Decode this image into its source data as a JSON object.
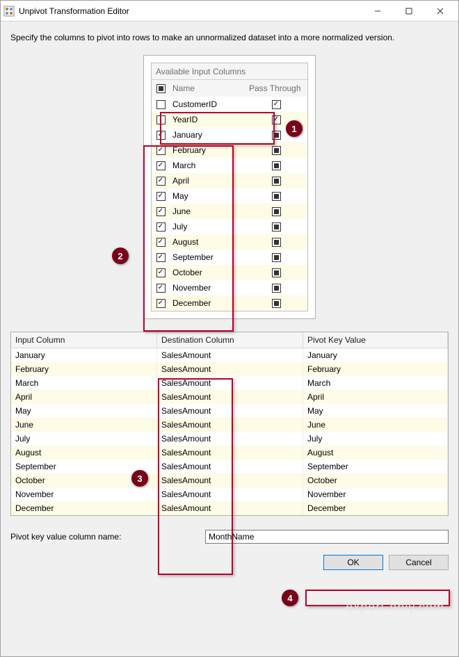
{
  "window": {
    "title": "Unpivot Transformation Editor",
    "description": "Specify the columns to pivot into rows to make an unnormalized dataset into a more normalized version."
  },
  "inputColumns": {
    "header_name": "Name",
    "header_pass": "Pass Through",
    "title": "Available Input Columns",
    "rows": [
      {
        "name": "CustomerID",
        "checked": false,
        "pass": "checked"
      },
      {
        "name": "YearID",
        "checked": false,
        "pass": "checked"
      },
      {
        "name": "January",
        "checked": true,
        "pass": "tristate"
      },
      {
        "name": "February",
        "checked": true,
        "pass": "tristate"
      },
      {
        "name": "March",
        "checked": true,
        "pass": "tristate"
      },
      {
        "name": "April",
        "checked": true,
        "pass": "tristate"
      },
      {
        "name": "May",
        "checked": true,
        "pass": "tristate"
      },
      {
        "name": "June",
        "checked": true,
        "pass": "tristate"
      },
      {
        "name": "July",
        "checked": true,
        "pass": "tristate"
      },
      {
        "name": "August",
        "checked": true,
        "pass": "tristate"
      },
      {
        "name": "September",
        "checked": true,
        "pass": "tristate"
      },
      {
        "name": "October",
        "checked": true,
        "pass": "tristate"
      },
      {
        "name": "November",
        "checked": true,
        "pass": "tristate"
      },
      {
        "name": "December",
        "checked": true,
        "pass": "tristate"
      }
    ]
  },
  "mapping": {
    "header_input": "Input Column",
    "header_dest": "Destination Column",
    "header_pkv": "Pivot Key Value",
    "rows": [
      {
        "in": "January",
        "dest": "SalesAmount",
        "pkv": "January"
      },
      {
        "in": "February",
        "dest": "SalesAmount",
        "pkv": "February"
      },
      {
        "in": "March",
        "dest": "SalesAmount",
        "pkv": "March"
      },
      {
        "in": "April",
        "dest": "SalesAmount",
        "pkv": "April"
      },
      {
        "in": "May",
        "dest": "SalesAmount",
        "pkv": "May"
      },
      {
        "in": "June",
        "dest": "SalesAmount",
        "pkv": "June"
      },
      {
        "in": "July",
        "dest": "SalesAmount",
        "pkv": "July"
      },
      {
        "in": "August",
        "dest": "SalesAmount",
        "pkv": "August"
      },
      {
        "in": "September",
        "dest": "SalesAmount",
        "pkv": "September"
      },
      {
        "in": "October",
        "dest": "SalesAmount",
        "pkv": "October"
      },
      {
        "in": "November",
        "dest": "SalesAmount",
        "pkv": "November"
      },
      {
        "in": "December",
        "dest": "SalesAmount",
        "pkv": "December"
      }
    ]
  },
  "pkvField": {
    "label": "Pivot key value column name:",
    "value": "MonthName"
  },
  "buttons": {
    "ok": "OK",
    "cancel": "Cancel"
  },
  "annotations": {
    "b1": "1",
    "b2": "2",
    "b3": "3",
    "b4": "4"
  },
  "watermark": "expert-only.com"
}
